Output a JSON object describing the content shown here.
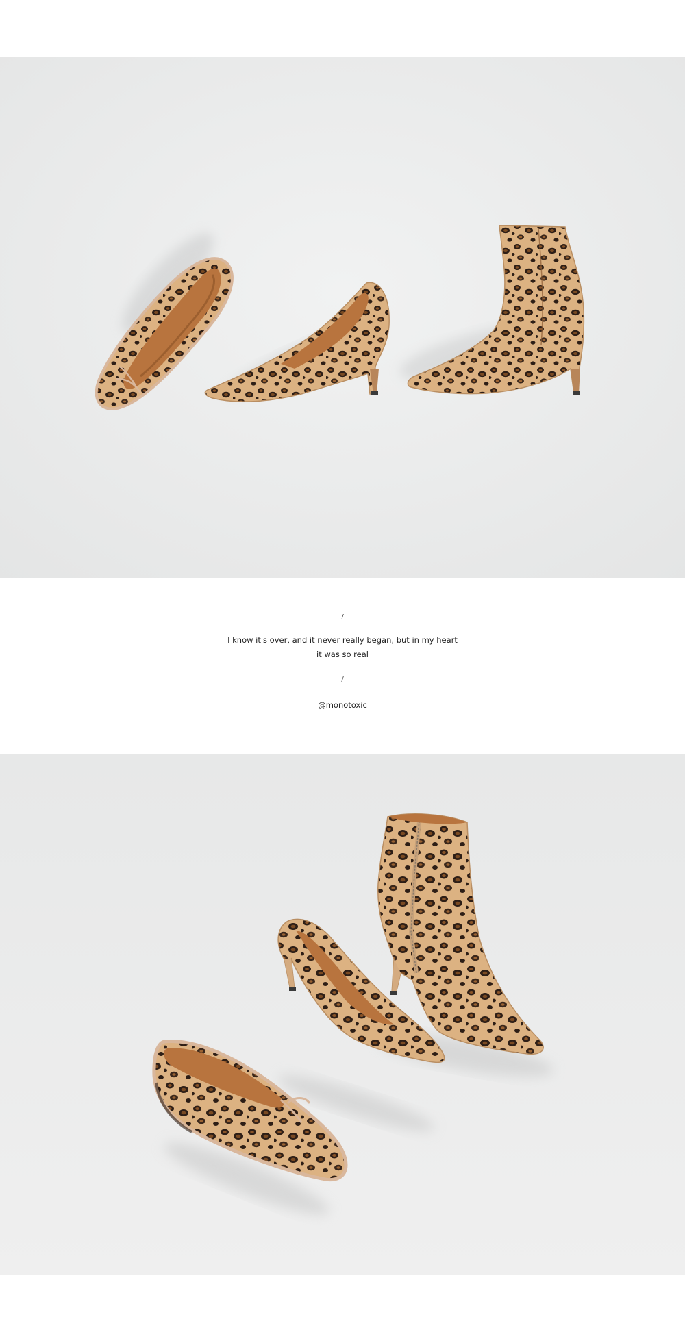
{
  "images": [
    {
      "name": "flatlay-photo",
      "alt": "Leopard print ballet flat, pointed pump and ankle boot lying on a pale grey backdrop",
      "colors": {
        "backdrop": "#e9eaea",
        "fur_base": "#dcb282",
        "spot_dark": "#2d1e16",
        "spot_brown": "#7a4a22",
        "lining": "#b8743e",
        "piping": "#d9b79c"
      }
    },
    {
      "name": "standing-photo",
      "alt": "Leopard print ballet flat, pump and ankle boot standing on a pale grey backdrop",
      "colors": {
        "backdrop": "#ebebeb",
        "fur_base": "#dcb282",
        "spot_dark": "#2d1e16",
        "spot_brown": "#7a4a22",
        "lining": "#b8743e",
        "piping": "#d9b79c"
      }
    }
  ],
  "caption": {
    "divider_top": "/",
    "quote_line_1": "I know it's over, and it never really began, but in my heart",
    "quote_line_2": "it was so real",
    "divider_bottom": "/",
    "handle": "@monotoxic"
  }
}
